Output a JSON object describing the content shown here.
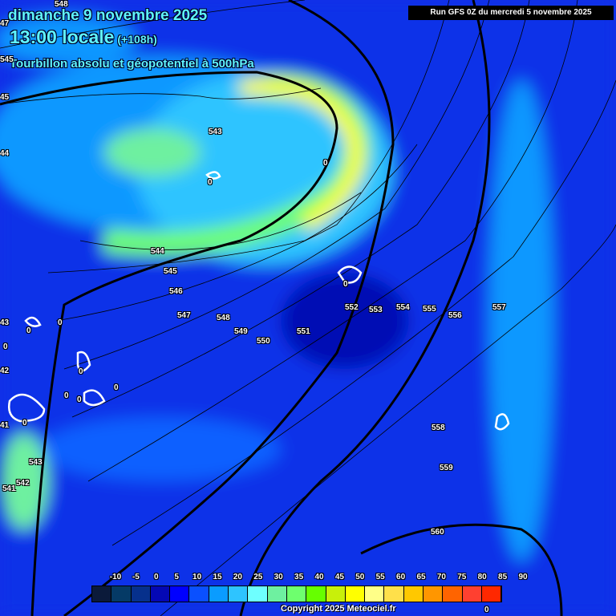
{
  "header": {
    "date": "dimanche 9 novembre 2025",
    "time": "13:00 locale",
    "lead": "(+108h)",
    "subtitle": "Tourbillon absolu et géopotentiel à 500hPa",
    "run": "Run GFS 0Z du mercredi 5 novembre 2025"
  },
  "contour_labels": [
    "548",
    "47",
    "545",
    "45",
    "44",
    "543",
    "0",
    "544",
    "545",
    "546",
    "547",
    "548",
    "549",
    "550",
    "551",
    "552",
    "553",
    "554",
    "555",
    "556",
    "557",
    "558",
    "559",
    "560",
    "43",
    "42",
    "41",
    "543",
    "542",
    "541",
    "0",
    "0",
    "0",
    "0",
    "0",
    "0",
    "0",
    "0",
    "0",
    "0",
    "0"
  ],
  "legend": {
    "ticks": [
      "-10",
      "-5",
      "0",
      "5",
      "10",
      "15",
      "20",
      "25",
      "30",
      "35",
      "40",
      "45",
      "50",
      "55",
      "60",
      "65",
      "70",
      "75",
      "80",
      "85",
      "90"
    ],
    "colors": [
      "#0b1a3a",
      "#053a66",
      "#06308c",
      "#0408b4",
      "#0000ff",
      "#0a50ff",
      "#0a9cff",
      "#2ec4ff",
      "#6effff",
      "#6ef0a0",
      "#6eff6e",
      "#66ff00",
      "#c8f00a",
      "#ffff00",
      "#ffff88",
      "#ffe04a",
      "#ffc800",
      "#ff9600",
      "#ff6400",
      "#ff4030",
      "#ff2800"
    ]
  },
  "copyright": "Copyright 2025 Meteociel.fr"
}
